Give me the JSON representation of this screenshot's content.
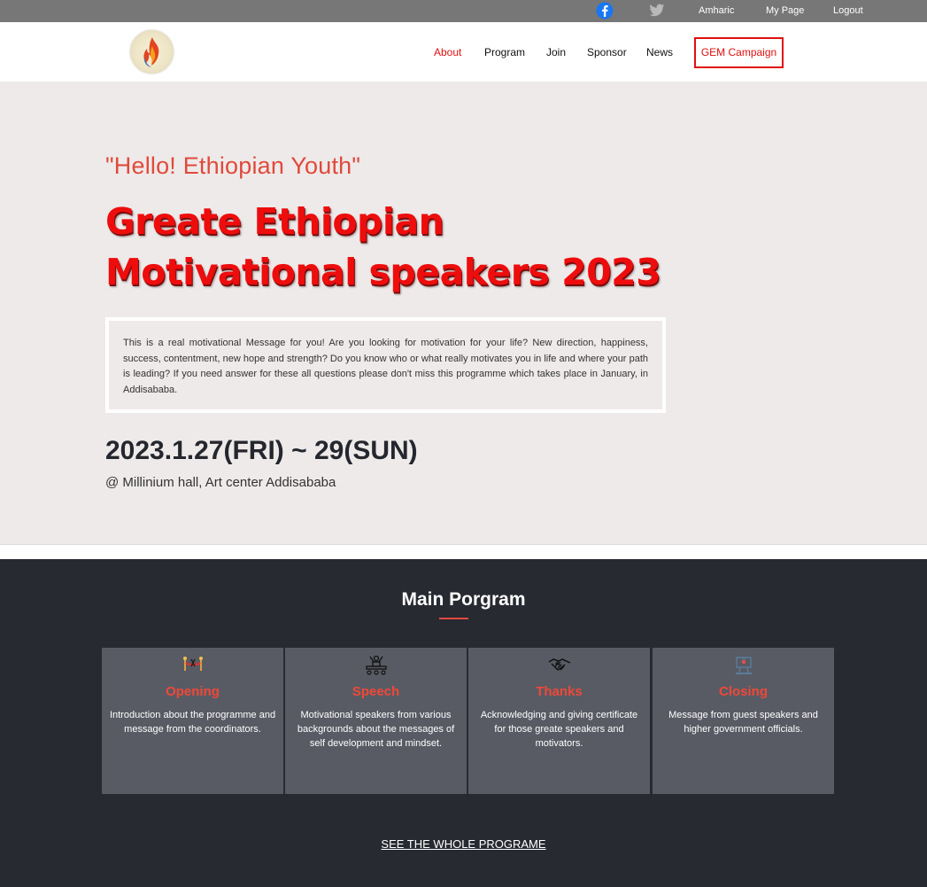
{
  "topbar": {
    "facebook_icon": "facebook-icon",
    "twitter_icon": "twitter-icon",
    "amharic": "Amharic",
    "my_page": "My Page",
    "logout": "Logout"
  },
  "header": {
    "logo_icon": "flame-logo-icon",
    "nav": [
      "About",
      "Program",
      "Join",
      "Sponsor",
      "News"
    ],
    "active_nav": "About",
    "gem_campaign": "GEM Campaign",
    "accent_color": "#e01010"
  },
  "hero": {
    "subtitle": "\"Hello! Ethiopian Youth\"",
    "title_line1": "Greate Ethiopian",
    "title_line2": "Motivational speakers 2023",
    "description": "This is a real motivational Message for you! Are you looking for motivation for your life? New direction, happiness, success, contentment, new hope and strength? Do you know who or what really motivates you in life and where your path is leading? If you need answer for these all questions please don't miss this programme which takes place in January, in Addisababa.",
    "date": "2023.1.27(FRI) ~ 29(SUN)",
    "venue": "@ Millinium hall, Art center Addisababa"
  },
  "program": {
    "title": "Main Porgram",
    "cards": [
      {
        "icon": "ribbon-cutting-icon",
        "title": "Opening",
        "desc": "Introduction about the programme and message from the coordinators."
      },
      {
        "icon": "speaker-stage-icon",
        "title": "Speech",
        "desc": "Motivational speakers from various backgrounds about the messages of self development and mindset."
      },
      {
        "icon": "handshake-icon",
        "title": "Thanks",
        "desc": "Acknowledging and giving certificate for those greate speakers and motivators."
      },
      {
        "icon": "official-podium-icon",
        "title": "Closing",
        "desc": "Message from guest speakers and higher government officials."
      }
    ],
    "see_all": "SEE THE WHOLE PROGRAME"
  }
}
